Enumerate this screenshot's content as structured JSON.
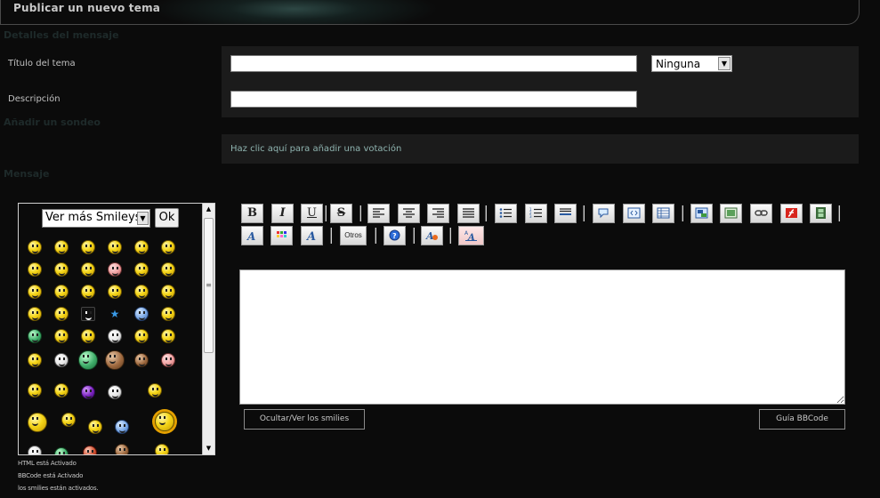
{
  "header": {
    "title": "Publicar un nuevo tema"
  },
  "sections": {
    "details": "Detalles del mensaje",
    "poll": "Añadir un sondeo",
    "message": "Mensaje"
  },
  "form": {
    "topic_title_label": "Título del tema",
    "topic_title_value": "",
    "prefix_select": "Ninguna",
    "description_label": "Descripción",
    "description_value": ""
  },
  "poll": {
    "add_link": "Haz clic aquí para añadir una votación"
  },
  "smileys": {
    "more_select": "Ver más Smileys",
    "ok_button": "Ok"
  },
  "toolbar": {
    "bold": "B",
    "italic": "I",
    "underline": "U",
    "strike": "S",
    "others": "Otros"
  },
  "editor": {
    "value": ""
  },
  "actions": {
    "toggle_smilies": "Ocultar/Ver los smilies",
    "bbcode_guide": "Guía BBCode"
  },
  "status_notes": [
    "HTML está Activado",
    "BBCode está Activado",
    "los smilies están activados."
  ],
  "colors": {
    "background": "#0b0b0b",
    "panel": "#1b1b1b",
    "link": "#8fb4b0"
  }
}
